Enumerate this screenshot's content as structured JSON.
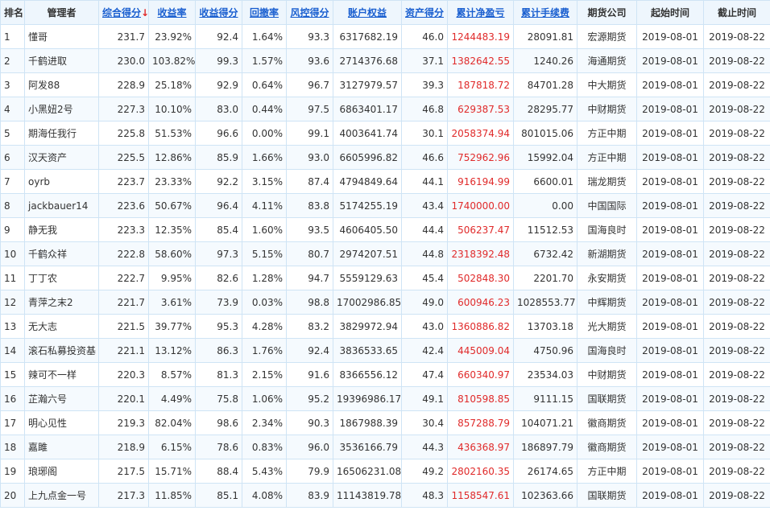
{
  "headers": [
    {
      "key": "rank",
      "label": "排名",
      "sortable": false
    },
    {
      "key": "manager",
      "label": "管理者",
      "sortable": false
    },
    {
      "key": "total_score",
      "label": "综合得分",
      "sortable": true,
      "sorted": true,
      "arrow": "↓"
    },
    {
      "key": "return_rate",
      "label": "收益率",
      "sortable": true
    },
    {
      "key": "return_score",
      "label": "收益得分",
      "sortable": true
    },
    {
      "key": "drawdown",
      "label": "回撤率",
      "sortable": true
    },
    {
      "key": "risk_score",
      "label": "风控得分",
      "sortable": true
    },
    {
      "key": "equity",
      "label": "账户权益",
      "sortable": true
    },
    {
      "key": "asset_score",
      "label": "资产得分",
      "sortable": true
    },
    {
      "key": "net_pnl",
      "label": "累计净盈亏",
      "sortable": true
    },
    {
      "key": "fees",
      "label": "累计手续费",
      "sortable": true
    },
    {
      "key": "firm",
      "label": "期货公司",
      "sortable": false
    },
    {
      "key": "start",
      "label": "起始时间",
      "sortable": false
    },
    {
      "key": "end",
      "label": "截止时间",
      "sortable": false
    }
  ],
  "colors": {
    "accent": "#1a5fd0",
    "profit": "#e02a2a",
    "header_bg": "#eef6fd",
    "border": "#cfe4f5"
  },
  "rows": [
    {
      "rank": "1",
      "manager": "懂哥",
      "total_score": "231.7",
      "return_rate": "23.92%",
      "return_score": "92.4",
      "drawdown": "1.64%",
      "risk_score": "93.3",
      "equity": "6317682.19",
      "asset_score": "46.0",
      "net_pnl": "1244483.19",
      "fees": "28091.81",
      "firm": "宏源期货",
      "start": "2019-08-01",
      "end": "2019-08-22"
    },
    {
      "rank": "2",
      "manager": "千鹤进取",
      "total_score": "230.0",
      "return_rate": "103.82%",
      "return_score": "99.3",
      "drawdown": "1.57%",
      "risk_score": "93.6",
      "equity": "2714376.68",
      "asset_score": "37.1",
      "net_pnl": "1382642.55",
      "fees": "1240.26",
      "firm": "海通期货",
      "start": "2019-08-01",
      "end": "2019-08-22"
    },
    {
      "rank": "3",
      "manager": "阿发88",
      "total_score": "228.9",
      "return_rate": "25.18%",
      "return_score": "92.9",
      "drawdown": "0.64%",
      "risk_score": "96.7",
      "equity": "3127979.57",
      "asset_score": "39.3",
      "net_pnl": "187818.72",
      "fees": "84701.28",
      "firm": "中大期货",
      "start": "2019-08-01",
      "end": "2019-08-22"
    },
    {
      "rank": "4",
      "manager": "小黑妞2号",
      "total_score": "227.3",
      "return_rate": "10.10%",
      "return_score": "83.0",
      "drawdown": "0.44%",
      "risk_score": "97.5",
      "equity": "6863401.17",
      "asset_score": "46.8",
      "net_pnl": "629387.53",
      "fees": "28295.77",
      "firm": "中财期货",
      "start": "2019-08-01",
      "end": "2019-08-22"
    },
    {
      "rank": "5",
      "manager": "期海任我行",
      "total_score": "225.8",
      "return_rate": "51.53%",
      "return_score": "96.6",
      "drawdown": "0.00%",
      "risk_score": "99.1",
      "equity": "4003641.74",
      "asset_score": "30.1",
      "net_pnl": "2058374.94",
      "fees": "801015.06",
      "firm": "方正中期",
      "start": "2019-08-01",
      "end": "2019-08-22"
    },
    {
      "rank": "6",
      "manager": "汉天资产",
      "total_score": "225.5",
      "return_rate": "12.86%",
      "return_score": "85.9",
      "drawdown": "1.66%",
      "risk_score": "93.0",
      "equity": "6605996.82",
      "asset_score": "46.6",
      "net_pnl": "752962.96",
      "fees": "15992.04",
      "firm": "方正中期",
      "start": "2019-08-01",
      "end": "2019-08-22"
    },
    {
      "rank": "7",
      "manager": "oyrb",
      "total_score": "223.7",
      "return_rate": "23.33%",
      "return_score": "92.2",
      "drawdown": "3.15%",
      "risk_score": "87.4",
      "equity": "4794849.64",
      "asset_score": "44.1",
      "net_pnl": "916194.99",
      "fees": "6600.01",
      "firm": "瑞龙期货",
      "start": "2019-08-01",
      "end": "2019-08-22"
    },
    {
      "rank": "8",
      "manager": "jackbauer14",
      "total_score": "223.6",
      "return_rate": "50.67%",
      "return_score": "96.4",
      "drawdown": "4.11%",
      "risk_score": "83.8",
      "equity": "5174255.19",
      "asset_score": "43.4",
      "net_pnl": "1740000.00",
      "fees": "0.00",
      "firm": "中国国际",
      "start": "2019-08-01",
      "end": "2019-08-22"
    },
    {
      "rank": "9",
      "manager": "静无我",
      "total_score": "223.3",
      "return_rate": "12.35%",
      "return_score": "85.4",
      "drawdown": "1.60%",
      "risk_score": "93.5",
      "equity": "4606405.50",
      "asset_score": "44.4",
      "net_pnl": "506237.47",
      "fees": "11512.53",
      "firm": "国海良时",
      "start": "2019-08-01",
      "end": "2019-08-22"
    },
    {
      "rank": "10",
      "manager": "千鹤众祥",
      "total_score": "222.8",
      "return_rate": "58.60%",
      "return_score": "97.3",
      "drawdown": "5.15%",
      "risk_score": "80.7",
      "equity": "2974207.51",
      "asset_score": "44.8",
      "net_pnl": "2318392.48",
      "fees": "6732.42",
      "firm": "新湖期货",
      "start": "2019-08-01",
      "end": "2019-08-22"
    },
    {
      "rank": "11",
      "manager": "丁丁农",
      "total_score": "222.7",
      "return_rate": "9.95%",
      "return_score": "82.6",
      "drawdown": "1.28%",
      "risk_score": "94.7",
      "equity": "5559129.63",
      "asset_score": "45.4",
      "net_pnl": "502848.30",
      "fees": "2201.70",
      "firm": "永安期货",
      "start": "2019-08-01",
      "end": "2019-08-22"
    },
    {
      "rank": "12",
      "manager": "青萍之末2",
      "total_score": "221.7",
      "return_rate": "3.61%",
      "return_score": "73.9",
      "drawdown": "0.03%",
      "risk_score": "98.8",
      "equity": "17002986.85",
      "asset_score": "49.0",
      "net_pnl": "600946.23",
      "fees": "1028553.77",
      "firm": "中辉期货",
      "start": "2019-08-01",
      "end": "2019-08-22"
    },
    {
      "rank": "13",
      "manager": "无大志",
      "total_score": "221.5",
      "return_rate": "39.77%",
      "return_score": "95.3",
      "drawdown": "4.28%",
      "risk_score": "83.2",
      "equity": "3829972.94",
      "asset_score": "43.0",
      "net_pnl": "1360886.82",
      "fees": "13703.18",
      "firm": "光大期货",
      "start": "2019-08-01",
      "end": "2019-08-22"
    },
    {
      "rank": "14",
      "manager": "滚石私募投资基",
      "total_score": "221.1",
      "return_rate": "13.12%",
      "return_score": "86.3",
      "drawdown": "1.76%",
      "risk_score": "92.4",
      "equity": "3836533.65",
      "asset_score": "42.4",
      "net_pnl": "445009.04",
      "fees": "4750.96",
      "firm": "国海良时",
      "start": "2019-08-01",
      "end": "2019-08-22"
    },
    {
      "rank": "15",
      "manager": "辣可不一样",
      "total_score": "220.3",
      "return_rate": "8.57%",
      "return_score": "81.3",
      "drawdown": "2.15%",
      "risk_score": "91.6",
      "equity": "8366556.12",
      "asset_score": "47.4",
      "net_pnl": "660340.97",
      "fees": "23534.03",
      "firm": "中财期货",
      "start": "2019-08-01",
      "end": "2019-08-22"
    },
    {
      "rank": "16",
      "manager": "芷瀚六号",
      "total_score": "220.1",
      "return_rate": "4.49%",
      "return_score": "75.8",
      "drawdown": "1.06%",
      "risk_score": "95.2",
      "equity": "19396986.17",
      "asset_score": "49.1",
      "net_pnl": "810598.85",
      "fees": "9111.15",
      "firm": "国联期货",
      "start": "2019-08-01",
      "end": "2019-08-22"
    },
    {
      "rank": "17",
      "manager": "明心见性",
      "total_score": "219.3",
      "return_rate": "82.04%",
      "return_score": "98.6",
      "drawdown": "2.34%",
      "risk_score": "90.3",
      "equity": "1867988.39",
      "asset_score": "30.4",
      "net_pnl": "857288.79",
      "fees": "104071.21",
      "firm": "徽商期货",
      "start": "2019-08-01",
      "end": "2019-08-22"
    },
    {
      "rank": "18",
      "manager": "嘉雎",
      "total_score": "218.9",
      "return_rate": "6.15%",
      "return_score": "78.6",
      "drawdown": "0.83%",
      "risk_score": "96.0",
      "equity": "3536166.79",
      "asset_score": "44.3",
      "net_pnl": "436368.97",
      "fees": "186897.79",
      "firm": "徽商期货",
      "start": "2019-08-01",
      "end": "2019-08-22"
    },
    {
      "rank": "19",
      "manager": "琅琊阁",
      "total_score": "217.5",
      "return_rate": "15.71%",
      "return_score": "88.4",
      "drawdown": "5.43%",
      "risk_score": "79.9",
      "equity": "16506231.08",
      "asset_score": "49.2",
      "net_pnl": "2802160.35",
      "fees": "26174.65",
      "firm": "方正中期",
      "start": "2019-08-01",
      "end": "2019-08-22"
    },
    {
      "rank": "20",
      "manager": "上九点金一号",
      "total_score": "217.3",
      "return_rate": "11.85%",
      "return_score": "85.1",
      "drawdown": "4.08%",
      "risk_score": "83.9",
      "equity": "11143819.78",
      "asset_score": "48.3",
      "net_pnl": "1158547.61",
      "fees": "102363.66",
      "firm": "国联期货",
      "start": "2019-08-01",
      "end": "2019-08-22"
    }
  ]
}
